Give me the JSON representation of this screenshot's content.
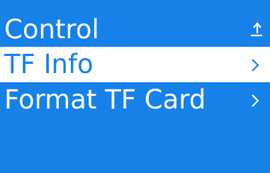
{
  "header": {
    "title": "Control",
    "back_icon": "return-up-arrow-icon"
  },
  "menu": {
    "items": [
      {
        "label": "TF Info",
        "selected": true,
        "icon": "chevron-right-icon"
      },
      {
        "label": "Format TF Card",
        "selected": false,
        "icon": "chevron-right-icon"
      }
    ]
  },
  "colors": {
    "background": "#1681e8",
    "highlight": "#ffffff",
    "text": "#ffffff",
    "selected_text": "#1681e8"
  }
}
